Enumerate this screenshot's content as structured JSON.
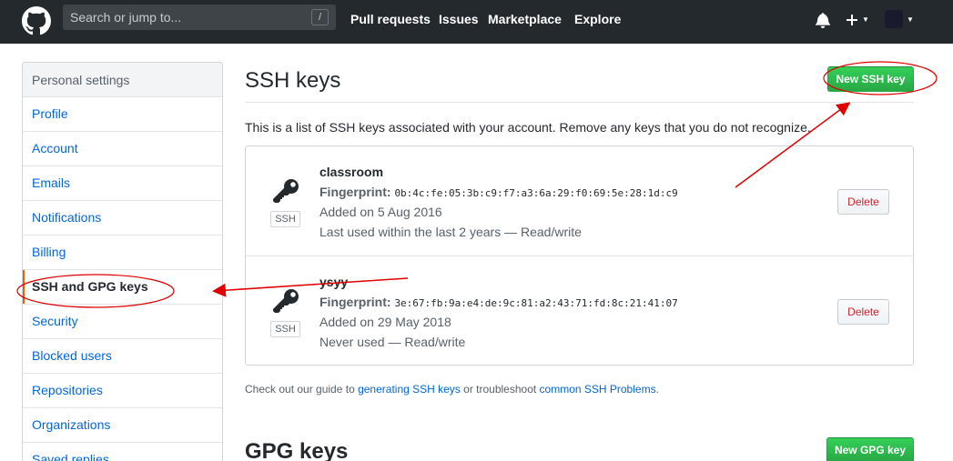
{
  "header": {
    "search_placeholder": "Search or jump to...",
    "search_shortcut": "/",
    "nav": [
      "Pull requests",
      "Issues",
      "Marketplace",
      "Explore"
    ],
    "icons": [
      "github-logo-icon",
      "bell-icon",
      "plus-icon",
      "avatar"
    ]
  },
  "sidebar": {
    "heading": "Personal settings",
    "items": [
      {
        "label": "Profile"
      },
      {
        "label": "Account"
      },
      {
        "label": "Emails"
      },
      {
        "label": "Notifications"
      },
      {
        "label": "Billing"
      },
      {
        "label": "SSH and GPG keys",
        "selected": true
      },
      {
        "label": "Security"
      },
      {
        "label": "Blocked users"
      },
      {
        "label": "Repositories"
      },
      {
        "label": "Organizations"
      },
      {
        "label": "Saved replies"
      }
    ]
  },
  "main": {
    "ssh_title": "SSH keys",
    "new_ssh_button": "New SSH key",
    "description": "This is a list of SSH keys associated with your account. Remove any keys that you do not recognize.",
    "keys": [
      {
        "title": "classroom",
        "fingerprint_label": "Fingerprint:",
        "fingerprint": "0b:4c:fe:05:3b:c9:f7:a3:6a:29:f0:69:5e:28:1d:c9",
        "added": "Added on 5 Aug 2016",
        "usage": "Last used within the last 2 years — Read/write",
        "badge": "SSH",
        "delete_label": "Delete"
      },
      {
        "title": "ysyy",
        "fingerprint_label": "Fingerprint:",
        "fingerprint": "3e:67:fb:9a:e4:de:9c:81:a2:43:71:fd:8c:21:41:07",
        "added": "Added on 29 May 2018",
        "usage": "Never used — Read/write",
        "badge": "SSH",
        "delete_label": "Delete"
      }
    ],
    "guide": {
      "prefix": "Check out our guide to ",
      "link1": "generating SSH keys",
      "middle": " or troubleshoot ",
      "link2": "common SSH Problems",
      "suffix": "."
    },
    "gpg_title": "GPG keys",
    "new_gpg_button": "New GPG key"
  },
  "colors": {
    "header_bg": "#24292e",
    "link": "#0366d6",
    "green": "#28a745",
    "danger": "#cb2431",
    "annotation": "#e00000"
  }
}
